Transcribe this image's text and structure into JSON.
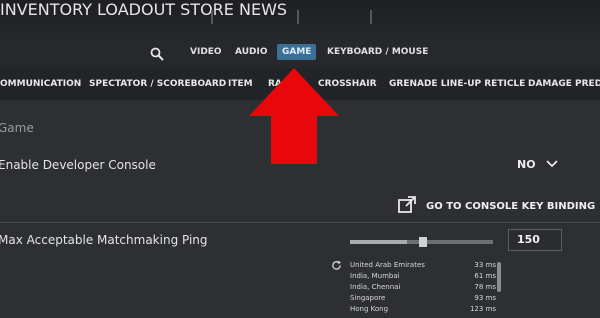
{
  "main_nav": {
    "items": [
      "INVENTORY",
      "LOADOUT",
      "STORE",
      "NEWS"
    ]
  },
  "settings_nav": {
    "items": [
      "VIDEO",
      "AUDIO",
      "GAME",
      "KEYBOARD / MOUSE"
    ],
    "active": "GAME"
  },
  "game_tabs": {
    "items": [
      "OMMUNICATION",
      "SPECTATOR / SCOREBOARD",
      "ITEM",
      "RA",
      "CROSSHAIR",
      "GRENADE LINE-UP RETICLE",
      "DAMAGE PREDIC"
    ]
  },
  "section": {
    "title": "Game"
  },
  "developer_console": {
    "label": "Enable Developer Console",
    "value": "NO"
  },
  "console_binding": {
    "label": "GO TO CONSOLE KEY BINDING"
  },
  "matchmaking_ping": {
    "label": "Max Acceptable Matchmaking Ping",
    "value": "150",
    "slider_level": 0.4
  },
  "ping_regions": [
    {
      "region": "United Arab Emirates",
      "ping": "33 ms"
    },
    {
      "region": "India, Mumbai",
      "ping": "61 ms"
    },
    {
      "region": "India, Chennai",
      "ping": "78 ms"
    },
    {
      "region": "Singapore",
      "ping": "93 ms"
    },
    {
      "region": "Hong Kong",
      "ping": "123 ms"
    }
  ],
  "colors": {
    "active_tab": "#3a6f96",
    "arrow": "#e8070a"
  },
  "icons": {
    "search": "search-icon",
    "chevron": "chevron-down-icon",
    "external": "external-link-icon",
    "refresh": "refresh-icon"
  }
}
